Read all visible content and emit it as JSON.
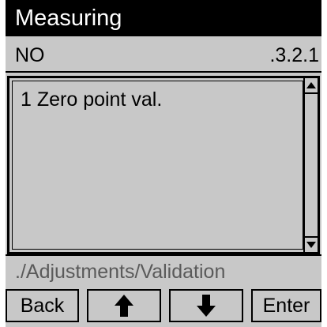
{
  "title": "Measuring",
  "header": {
    "left": "NO",
    "right": ".3.2.1"
  },
  "list": {
    "items": [
      {
        "label": "1 Zero point val."
      }
    ]
  },
  "path": "./Adjustments/Validation",
  "softkeys": {
    "back": "Back",
    "up_icon": "up-arrow-icon",
    "down_icon": "down-arrow-icon",
    "enter": "Enter"
  },
  "colors": {
    "background": "#c8c8c8",
    "title_bar": "#000000",
    "path_text": "#5a5a5a"
  }
}
